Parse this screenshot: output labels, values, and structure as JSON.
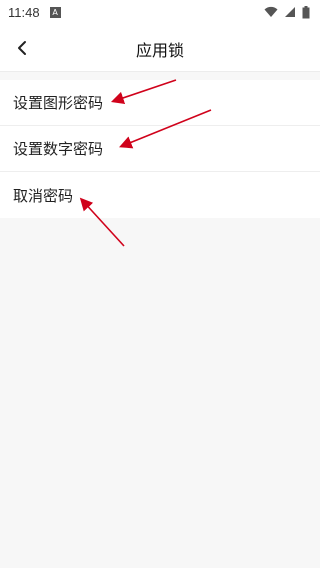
{
  "status_bar": {
    "time": "11:48",
    "notification_icon": "a-letter-icon",
    "icons": [
      "wifi-icon",
      "signal-icon",
      "battery-icon"
    ]
  },
  "header": {
    "title": "应用锁",
    "back_icon": "chevron-left-icon"
  },
  "menu": {
    "items": [
      {
        "label": "设置图形密码"
      },
      {
        "label": "设置数字密码"
      },
      {
        "label": "取消密码"
      }
    ]
  },
  "annotation_color": "#d0021b"
}
